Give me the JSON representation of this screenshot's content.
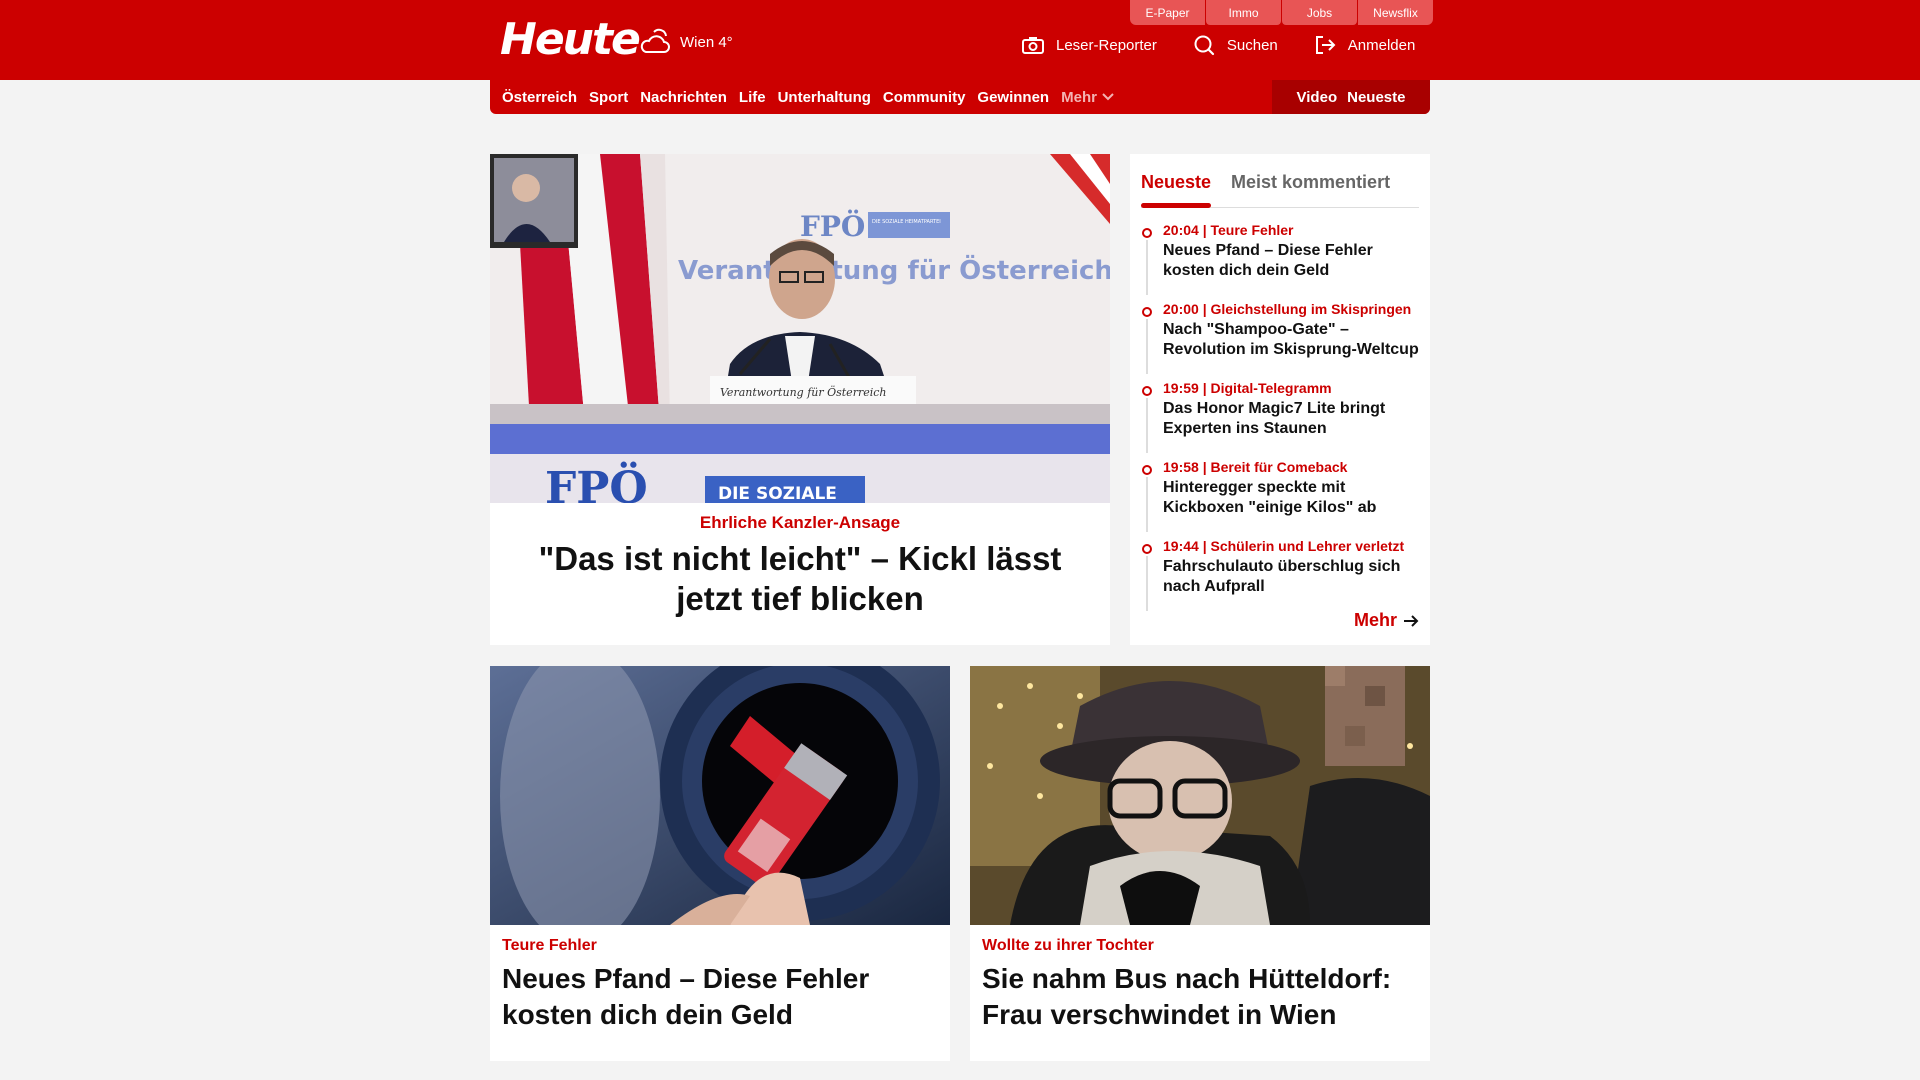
{
  "header": {
    "logo": "Heute",
    "weather": "Wien 4°",
    "util_tabs": [
      "E-Paper",
      "Immo",
      "Jobs",
      "Newsflix"
    ],
    "actions": {
      "reporter": "Leser-Reporter",
      "search": "Suchen",
      "login": "Anmelden"
    }
  },
  "nav": {
    "items": [
      "Österreich",
      "Sport",
      "Nachrichten",
      "Life",
      "Unterhaltung",
      "Community",
      "Gewinnen"
    ],
    "more": "Mehr",
    "right": [
      "Video",
      "Neueste"
    ]
  },
  "hero": {
    "kicker": "Ehrliche Kanzler-Ansage",
    "title": "\"Das ist nicht leicht\" – Kickl lässt jetzt tief blicken",
    "image_texts": {
      "party": "FPÖ",
      "party_tag": "DIE SOZIALE HEIMATPARTEI",
      "banner": "Verantwortung für Österreich",
      "lectern": "Verantwortung für Österreich",
      "bottom": "FPÖ",
      "bottom_tag": "DIE SOZIALE"
    }
  },
  "sidebar": {
    "tabs": [
      "Neueste",
      "Meist kommentiert"
    ],
    "items": [
      {
        "meta": "20:04 | Teure Fehler",
        "title": "Neues Pfand – Diese Fehler kosten dich dein Geld"
      },
      {
        "meta": "20:00 | Gleichstellung im Skispringen",
        "title": "Nach \"Shampoo-Gate\" – Revolution im Skisprung-Weltcup"
      },
      {
        "meta": "19:59 | Digital-Telegramm",
        "title": "Das Honor Magic7 Lite bringt Experten ins Staunen"
      },
      {
        "meta": "19:58 | Bereit für Comeback",
        "title": "Hinteregger speckte mit Kickboxen \"einige Kilos\" ab"
      },
      {
        "meta": "19:44 | Schülerin und Lehrer verletzt",
        "title": "Fahrschulauto überschlug sich nach Aufprall"
      }
    ],
    "more": "Mehr"
  },
  "cards": [
    {
      "kicker": "Teure Fehler",
      "title": "Neues Pfand – Diese Fehler kosten dich dein Geld"
    },
    {
      "kicker": "Wollte zu ihrer Tochter",
      "title": "Sie nahm Bus nach Hütteldorf: Frau verschwindet in Wien"
    }
  ],
  "colors": {
    "brand": "#cc0000",
    "brand_dark": "#a80000",
    "background": "#f3f3f3"
  }
}
